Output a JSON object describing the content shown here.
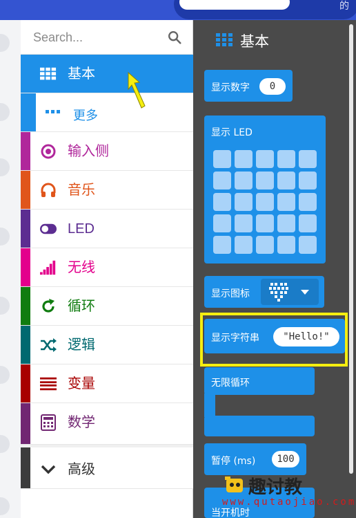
{
  "header": {
    "tail_text": "的"
  },
  "search": {
    "placeholder": "Search..."
  },
  "categories": [
    {
      "key": "basic",
      "label": "基本",
      "color": "#1e90e8",
      "icon": "grid-icon",
      "selected": true
    },
    {
      "key": "more",
      "label": "更多",
      "color": "#1e90e8",
      "icon": "more-dots-icon"
    },
    {
      "key": "input",
      "label": "输入侧",
      "color": "#b0279b",
      "icon": "target-icon"
    },
    {
      "key": "music",
      "label": "音乐",
      "color": "#e0551b",
      "icon": "headphones-icon"
    },
    {
      "key": "led",
      "label": "LED",
      "color": "#5c2d91",
      "icon": "toggle-icon"
    },
    {
      "key": "radio",
      "label": "无线",
      "color": "#e3008c",
      "icon": "signal-bars-icon"
    },
    {
      "key": "loops",
      "label": "循环",
      "color": "#107c10",
      "icon": "refresh-icon"
    },
    {
      "key": "logic",
      "label": "逻辑",
      "color": "#006970",
      "icon": "shuffle-icon"
    },
    {
      "key": "variables",
      "label": "变量",
      "color": "#a80000",
      "icon": "lines-icon"
    },
    {
      "key": "math",
      "label": "数学",
      "color": "#712672",
      "icon": "calculator-icon"
    },
    {
      "key": "advanced",
      "label": "高级",
      "color": "#3c3c3c",
      "icon": "chevron-down-icon"
    }
  ],
  "flyout": {
    "title": "基本",
    "blocks": {
      "show_number": {
        "label": "显示数字",
        "value": "0"
      },
      "show_leds": {
        "label": "显示 LED"
      },
      "show_icon": {
        "label": "显示图标"
      },
      "show_string": {
        "label": "显示字符串",
        "value": "\"Hello!\""
      },
      "forever": {
        "label": "无限循环"
      },
      "pause": {
        "label": "暂停 (ms)",
        "value": "100"
      },
      "on_start": {
        "label": "当开机时"
      }
    }
  },
  "watermark": {
    "brand": "趣讨教",
    "url": "www.qutaojiao.com"
  }
}
